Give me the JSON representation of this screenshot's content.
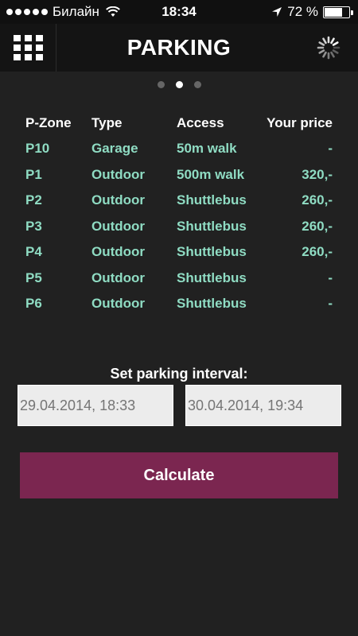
{
  "status_bar": {
    "carrier": "Билайн",
    "time": "18:34",
    "battery": "72 %",
    "battery_level": 0.72
  },
  "nav": {
    "title": "PARKING",
    "menu_icon": "grid-menu-icon",
    "refresh_icon": "spinner-icon"
  },
  "pager": {
    "count": 3,
    "active": 2
  },
  "table": {
    "headers": [
      "P-Zone",
      "Type",
      "Access",
      "Your price"
    ],
    "rows": [
      [
        "P10",
        "Garage",
        "50m walk",
        "-"
      ],
      [
        "P1",
        "Outdoor",
        "500m walk",
        "320,-"
      ],
      [
        "P2",
        "Outdoor",
        "Shuttlebus",
        "260,-"
      ],
      [
        "P3",
        "Outdoor",
        "Shuttlebus",
        "260,-"
      ],
      [
        "P4",
        "Outdoor",
        "Shuttlebus",
        "260,-"
      ],
      [
        "P5",
        "Outdoor",
        "Shuttlebus",
        "-"
      ],
      [
        "P6",
        "Outdoor",
        "Shuttlebus",
        "-"
      ]
    ]
  },
  "interval": {
    "label": "Set parking interval:",
    "from": "29.04.2014, 18:33",
    "to": "30.04.2014, 19:34"
  },
  "calculate_label": "Calculate",
  "colors": {
    "background": "#212121",
    "accent": "#7b2650",
    "table_text": "#8fdcc3"
  }
}
